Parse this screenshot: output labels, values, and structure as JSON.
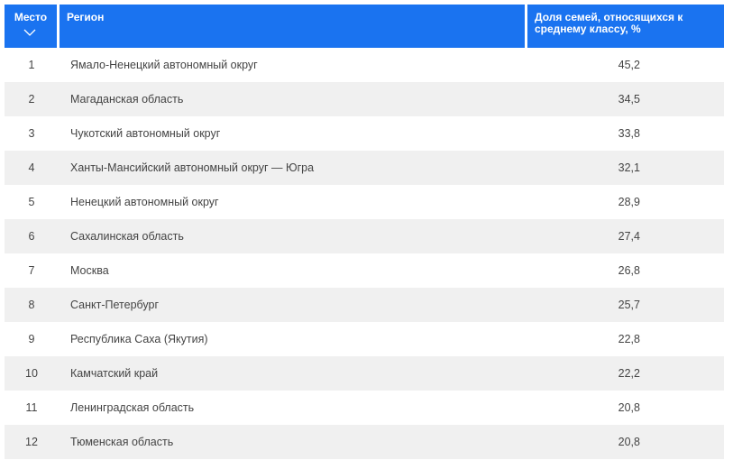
{
  "table": {
    "headers": {
      "rank": "Место",
      "region": "Регион",
      "share": "Доля семей, относящихся к среднему классу, %"
    },
    "rows": [
      {
        "rank": "1",
        "region": "Ямало-Ненецкий автономный округ",
        "share": "45,2"
      },
      {
        "rank": "2",
        "region": "Магаданская область",
        "share": "34,5"
      },
      {
        "rank": "3",
        "region": "Чукотский автономный округ",
        "share": "33,8"
      },
      {
        "rank": "4",
        "region": "Ханты-Мансийский автономный округ — Югра",
        "share": "32,1"
      },
      {
        "rank": "5",
        "region": "Ненецкий автономный округ",
        "share": "28,9"
      },
      {
        "rank": "6",
        "region": "Сахалинская область",
        "share": "27,4"
      },
      {
        "rank": "7",
        "region": "Москва",
        "share": "26,8"
      },
      {
        "rank": "8",
        "region": "Санкт-Петербург",
        "share": "25,7"
      },
      {
        "rank": "9",
        "region": "Республика Саха (Якутия)",
        "share": "22,8"
      },
      {
        "rank": "10",
        "region": "Камчатский край",
        "share": "22,2"
      },
      {
        "rank": "11",
        "region": "Ленинградская область",
        "share": "20,8"
      },
      {
        "rank": "12",
        "region": "Тюменская область",
        "share": "20,8"
      }
    ]
  },
  "colors": {
    "header_bg": "#1a73f0",
    "header_text": "#ffffff",
    "row_alt_bg": "#f0f0f0",
    "body_text": "#444444"
  },
  "icons": {
    "sort": "chevron-down-icon"
  }
}
